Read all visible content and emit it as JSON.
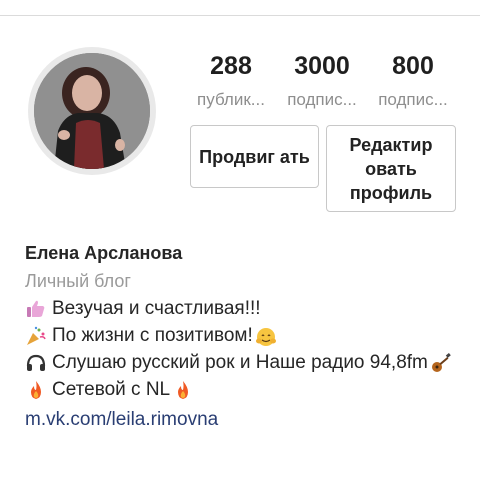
{
  "profile": {
    "stats": [
      {
        "value": "288",
        "label": "публик..."
      },
      {
        "value": "3000",
        "label": "подпис..."
      },
      {
        "value": "800",
        "label": "подпис..."
      }
    ],
    "buttons": {
      "promote_label": "Продвиг ать",
      "edit_label": "Редактир овать профиль"
    },
    "bio": {
      "name": "Елена Арсланова",
      "category": "Личный блог",
      "lines": [
        "Везучая и счастливая!!!",
        "По жизни с позитивом!",
        "Слушаю русский рок и Наше радио 94,8fm",
        "Сетевой с NL"
      ],
      "link": "m.vk.com/leila.rimovna"
    }
  },
  "icons": {
    "line1": "thumbs-up-icon",
    "line2": "party-popper-icon",
    "line2_end": "hugging-face-icon",
    "line3": "headphones-icon",
    "line3_end": "guitar-icon",
    "line4": "fire-icon"
  },
  "colors": {
    "link": "#2a3e73",
    "muted": "#8e8e8e",
    "border": "#c8c8c8"
  }
}
